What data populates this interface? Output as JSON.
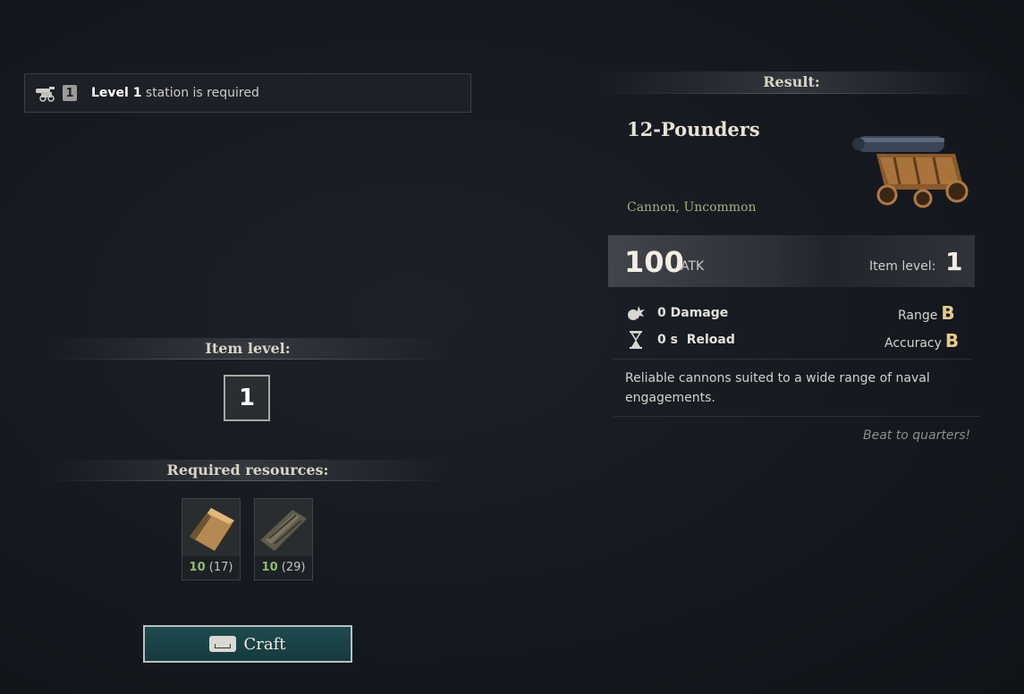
{
  "requirement": {
    "level_text": "Level 1",
    "rest_text": " station is required",
    "badge": "1",
    "icon": "cannon-icon"
  },
  "item_level": {
    "header": "Item level:",
    "value": "1"
  },
  "resources": {
    "header": "Required resources:",
    "items": [
      {
        "icon": "iron-ingot-icon",
        "have": "10",
        "total": "(17)"
      },
      {
        "icon": "timber-icon",
        "have": "10",
        "total": "(29)"
      }
    ]
  },
  "craft_button": {
    "label": "Craft",
    "key_icon": "spacebar-key-icon"
  },
  "result": {
    "header": "Result:",
    "name": "12-Pounders",
    "type": "Cannon, Uncommon",
    "atk_value": "100",
    "atk_unit": "ATK",
    "item_level_label": "Item level:",
    "item_level_value": "1",
    "stats": {
      "damage_value": "0",
      "damage_label": "Damage",
      "reload_value": "0 s",
      "reload_label": "Reload",
      "range_label": "Range",
      "range_grade": "B",
      "accuracy_label": "Accuracy",
      "accuracy_grade": "B"
    },
    "description": "Reliable cannons suited to a wide range of naval engagements.",
    "flavor": "Beat to quarters!"
  },
  "colors": {
    "accent_green": "#8fbf6a",
    "grade_gold": "#e6c98a",
    "button_teal": "#1e4b50",
    "type_olive": "#a3b07a"
  }
}
